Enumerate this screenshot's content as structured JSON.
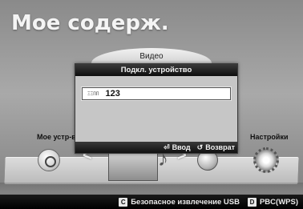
{
  "page": {
    "title": "Мое содерж."
  },
  "menu": {
    "top_tab": "Видео",
    "left_label": "Мое устр-во",
    "right_label": "Настройки"
  },
  "dialog": {
    "header": "Подкл. устройство",
    "input_tag": "ΞΞΠΠ",
    "input_value": "123",
    "enter_label": "Ввод",
    "return_label": "Возврат",
    "enter_icon": "enter-icon",
    "return_icon": "return-icon"
  },
  "bottom_bar": {
    "c_key": "C",
    "c_label": "Безопасное извлечение USB",
    "d_key": "D",
    "d_label": "PBC(WPS)"
  }
}
